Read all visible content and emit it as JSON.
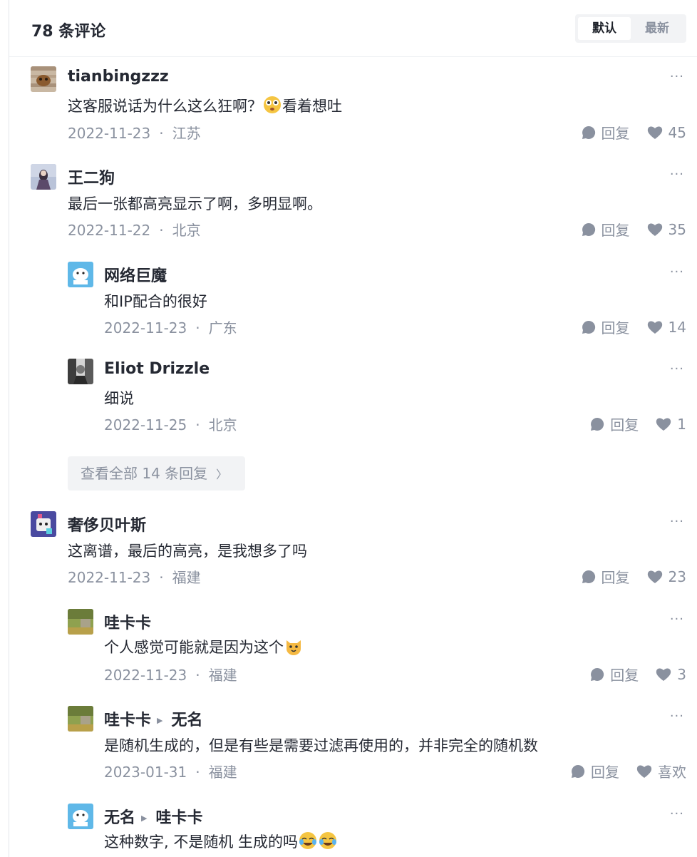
{
  "header": {
    "title": "78 条评论",
    "sort_default": "默认",
    "sort_latest": "最新"
  },
  "comments": [
    {
      "name": "tianbingzzz",
      "content": "这客服说话为什么这么狂啊？",
      "content_after": "看着想吐",
      "date": "2022-11-23",
      "location": "江苏",
      "reply_label": "回复",
      "likes": "45"
    },
    {
      "name": "王二狗",
      "content": "最后一张都高亮显示了啊，多明显啊。",
      "date": "2022-11-22",
      "location": "北京",
      "reply_label": "回复",
      "likes": "35"
    },
    {
      "name": "网络巨魔",
      "content": "和IP配合的很好",
      "date": "2022-11-23",
      "location": "广东",
      "reply_label": "回复",
      "likes": "14"
    },
    {
      "name": "Eliot Drizzle",
      "content": "细说",
      "date": "2022-11-25",
      "location": "北京",
      "reply_label": "回复",
      "likes": "1"
    },
    {
      "name": "奢侈贝叶斯",
      "content": "这离谱，最后的高亮，是我想多了吗",
      "date": "2022-11-23",
      "location": "福建",
      "reply_label": "回复",
      "likes": "23"
    },
    {
      "name": "哇卡卡",
      "content": "个人感觉可能就是因为这个",
      "date": "2022-11-23",
      "location": "福建",
      "reply_label": "回复",
      "likes": "3"
    },
    {
      "name": "哇卡卡",
      "reply_to": "无名",
      "content": "是随机生成的，但是有些是需要过滤再使用的，并非完全的随机数",
      "date": "2023-01-31",
      "location": "福建",
      "reply_label": "回复",
      "likes": "喜欢"
    },
    {
      "name": "无名",
      "reply_to": "哇卡卡",
      "content": "这种数字, 不是随机 生成的吗"
    }
  ],
  "view_all": {
    "label": "查看全部 14 条回复",
    "chevron": "〉"
  },
  "dot": "·",
  "more": "···",
  "icons": {
    "reply": "comment-bubble-icon",
    "like": "heart-icon",
    "more": "more-dots-icon"
  },
  "colors": {
    "text": "#252933",
    "muted": "#8a919f",
    "bg_button": "#f2f3f5"
  }
}
